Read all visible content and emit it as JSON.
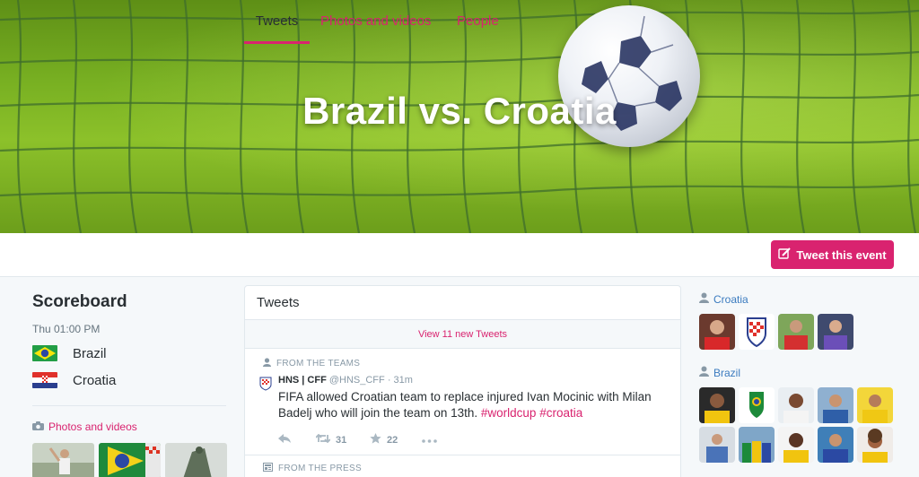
{
  "hero": {
    "title": "Brazil vs. Croatia"
  },
  "tabs": [
    {
      "label": "Tweets",
      "active": true
    },
    {
      "label": "Photos and videos",
      "active": false
    },
    {
      "label": "People",
      "active": false
    }
  ],
  "actions": {
    "tweet_event_label": "Tweet this event",
    "tweet_event_icon": "compose-icon"
  },
  "scoreboard": {
    "title": "Scoreboard",
    "time": "Thu 01:00 PM",
    "teams": [
      {
        "name": "Brazil",
        "flag": "brazil-flag"
      },
      {
        "name": "Croatia",
        "flag": "croatia-flag"
      }
    ],
    "photos_link": "Photos and videos"
  },
  "feed": {
    "header": "Tweets",
    "new_tweets": "View 11 new Tweets",
    "context1": "FROM THE TEAMS",
    "tweet": {
      "name": "HNS | CFF",
      "handle": "@HNS_CFF",
      "age": "· 31m",
      "text_plain": "FIFA allowed Croatian team to replace injured Ivan Mocinic with Milan Badelj who will join the team on 13th.",
      "hashtag1": "#worldcup",
      "hashtag2": "#croatia",
      "retweets": "31",
      "favorites": "22"
    },
    "context2": "FROM THE PRESS"
  },
  "people": {
    "croatia_label": "Croatia",
    "brazil_label": "Brazil"
  },
  "colors": {
    "accent": "#d9236f",
    "link_blue": "#3b7bbf",
    "text": "#292f33",
    "muted": "#8899a6"
  }
}
